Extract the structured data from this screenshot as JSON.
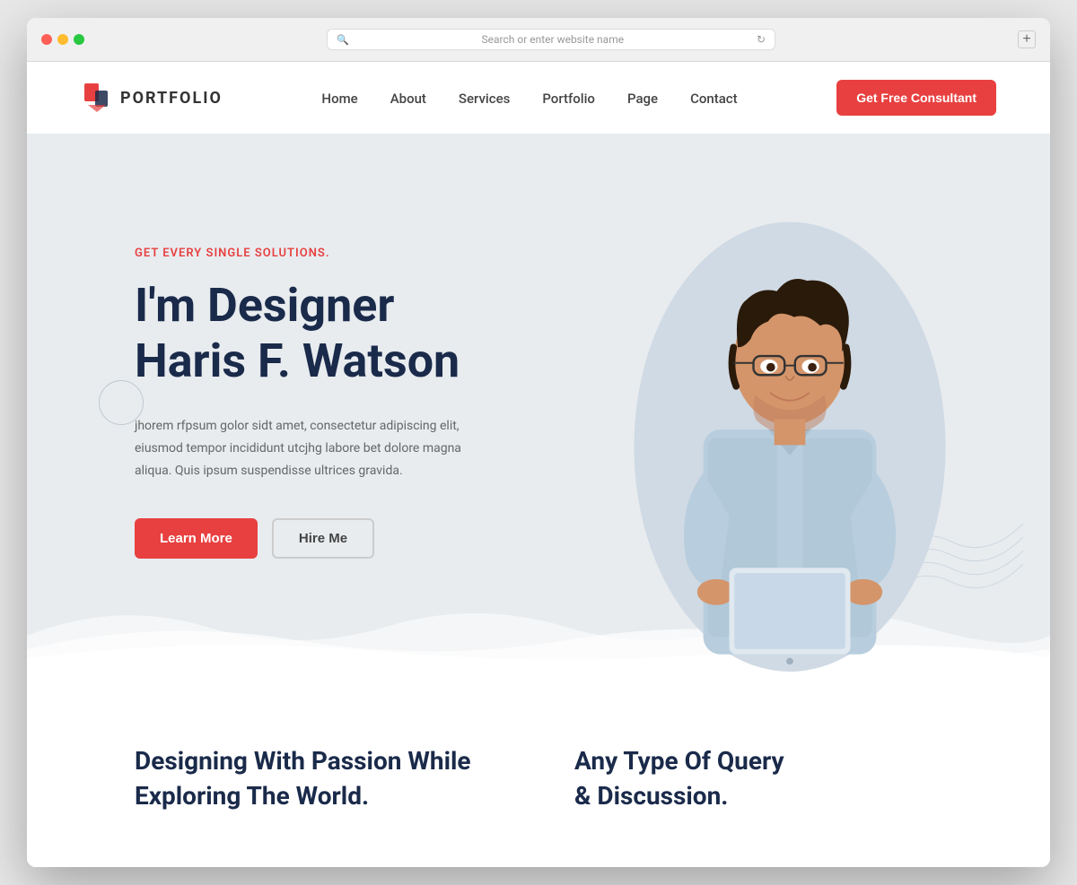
{
  "browser": {
    "address_placeholder": "Search or enter website name",
    "new_tab_icon": "+"
  },
  "navbar": {
    "logo_text": "PORTFOLIO",
    "nav_items": [
      {
        "label": "Home",
        "href": "#"
      },
      {
        "label": "About",
        "href": "#"
      },
      {
        "label": "Services",
        "href": "#"
      },
      {
        "label": "Portfolio",
        "href": "#"
      },
      {
        "label": "Page",
        "href": "#"
      },
      {
        "label": "Contact",
        "href": "#"
      }
    ],
    "cta_button": "Get Free Consultant"
  },
  "hero": {
    "subtitle": "GET EVERY SINGLE SOLUTIONS.",
    "title_line1": "I'm Designer",
    "title_line2": "Haris F. Watson",
    "description": "jhorem rfpsum golor sidt amet, consectetur adipiscing elit, eiusmod tempor incididunt utcjhg labore bet dolore magna aliqua. Quis ipsum suspendisse ultrices gravida.",
    "btn_learn_more": "Learn More",
    "btn_hire_me": "Hire Me"
  },
  "bottom": {
    "left_heading_line1": "Designing With Passion While",
    "left_heading_line2": "Exploring The World.",
    "right_heading_line1": "Any Type Of Query",
    "right_heading_line2": "& Discussion."
  },
  "colors": {
    "accent": "#e84040",
    "dark_blue": "#1a2a4a",
    "hero_bg": "#e8ecef"
  }
}
